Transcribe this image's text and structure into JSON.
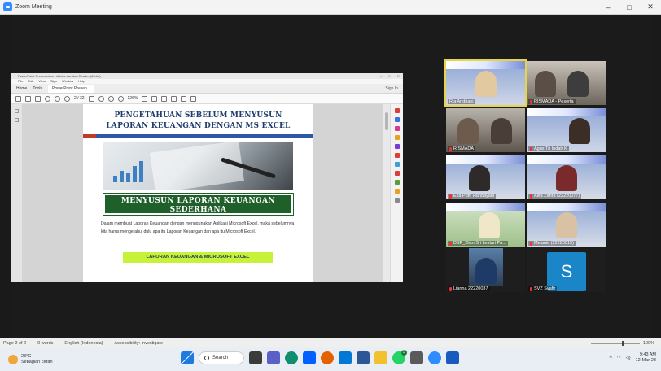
{
  "window": {
    "title": "Zoom Meeting",
    "controls": [
      "–",
      "□",
      "✕"
    ]
  },
  "share": {
    "app_title": "PowerPoint Presentation - Adobe Acrobat Reader (64-bit)",
    "menu": [
      "File",
      "Edit",
      "View",
      "Sign",
      "Window",
      "Help"
    ],
    "tabs": [
      "Home",
      "Tools",
      "PowerPoint Presen..."
    ],
    "sign_in": "Sign In",
    "page_indicator": "2 / 32",
    "zoom": "126%",
    "page": {
      "heading_line1": "PENGETAHUAN SEBELUM MENYUSUN",
      "heading_line2": "LAPORAN KEUANGAN DENGAN MS EXCEL",
      "banner_line1": "MENYUSUN LAPORAN KEUANGAN",
      "banner_line2": "SEDERHANA",
      "paragraph": "Dalam membuat Laporan Keuangan dengan menggunakan Aplikasi Microsoft Excel, maka sebelumnya kita harus mengetahui dulu apa itu Laporan Keuangan dan apa itu Microsoft Excel.",
      "highlight": "LAPORAN KEUANGAN & MICROSOFT EXCEL"
    }
  },
  "participants": [
    {
      "name": "Ria Andriani",
      "active": true
    },
    {
      "name": "RISMADA - Peserta",
      "active": false
    },
    {
      "name": "RISMADA",
      "active": false
    },
    {
      "name": "Agus Tri Indah K",
      "active": false
    },
    {
      "name": "Eka Putri Handayani",
      "active": false
    },
    {
      "name": "Alifa Zahra (22220077)",
      "active": false
    },
    {
      "name": "DSP_Dian Sri Lestari Pu...",
      "active": false
    },
    {
      "name": "Melanie (22220015)",
      "active": false
    },
    {
      "name": "Lianna 22220037",
      "active": false
    },
    {
      "name": "SVZ Syafir",
      "active": false,
      "initial": "S"
    }
  ],
  "statusbar": {
    "page": "Page 2 of 2",
    "words": "0 words",
    "language": "English (Indonesia)",
    "accessibility": "Accessibility: Investigate",
    "zoom": "100%"
  },
  "taskbar": {
    "weather_temp": "28°C",
    "weather_desc": "Sebagian cerah",
    "search_label": "Search",
    "whatsapp_badge": "3",
    "time": "9:43 AM",
    "date": "12-Mar-23"
  }
}
